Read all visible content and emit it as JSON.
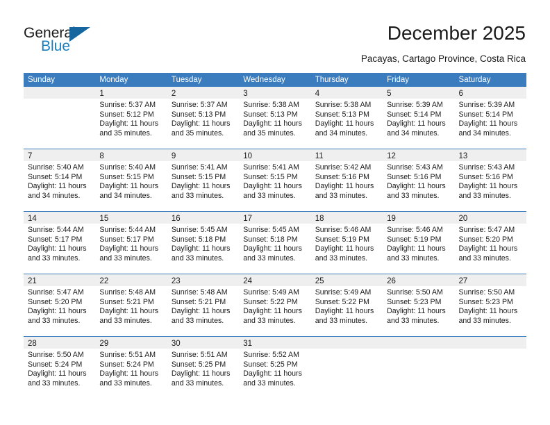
{
  "brand": {
    "name_top": "General",
    "name_bottom": "Blue",
    "triangle_icon": "triangle-icon",
    "accent_color": "#1a7fc1",
    "triangle_color": "#15659e"
  },
  "header": {
    "title": "December 2025",
    "subtitle": "Pacayas, Cartago Province, Costa Rica"
  },
  "calendar": {
    "header_bg": "#3a7cbe",
    "daynum_bg": "#efefef",
    "weekdays": [
      "Sunday",
      "Monday",
      "Tuesday",
      "Wednesday",
      "Thursday",
      "Friday",
      "Saturday"
    ],
    "weeks": [
      [
        {
          "day": "",
          "lines": []
        },
        {
          "day": "1",
          "lines": [
            "Sunrise: 5:37 AM",
            "Sunset: 5:12 PM",
            "Daylight: 11 hours",
            "and 35 minutes."
          ]
        },
        {
          "day": "2",
          "lines": [
            "Sunrise: 5:37 AM",
            "Sunset: 5:13 PM",
            "Daylight: 11 hours",
            "and 35 minutes."
          ]
        },
        {
          "day": "3",
          "lines": [
            "Sunrise: 5:38 AM",
            "Sunset: 5:13 PM",
            "Daylight: 11 hours",
            "and 35 minutes."
          ]
        },
        {
          "day": "4",
          "lines": [
            "Sunrise: 5:38 AM",
            "Sunset: 5:13 PM",
            "Daylight: 11 hours",
            "and 34 minutes."
          ]
        },
        {
          "day": "5",
          "lines": [
            "Sunrise: 5:39 AM",
            "Sunset: 5:14 PM",
            "Daylight: 11 hours",
            "and 34 minutes."
          ]
        },
        {
          "day": "6",
          "lines": [
            "Sunrise: 5:39 AM",
            "Sunset: 5:14 PM",
            "Daylight: 11 hours",
            "and 34 minutes."
          ]
        }
      ],
      [
        {
          "day": "7",
          "lines": [
            "Sunrise: 5:40 AM",
            "Sunset: 5:14 PM",
            "Daylight: 11 hours",
            "and 34 minutes."
          ]
        },
        {
          "day": "8",
          "lines": [
            "Sunrise: 5:40 AM",
            "Sunset: 5:15 PM",
            "Daylight: 11 hours",
            "and 34 minutes."
          ]
        },
        {
          "day": "9",
          "lines": [
            "Sunrise: 5:41 AM",
            "Sunset: 5:15 PM",
            "Daylight: 11 hours",
            "and 33 minutes."
          ]
        },
        {
          "day": "10",
          "lines": [
            "Sunrise: 5:41 AM",
            "Sunset: 5:15 PM",
            "Daylight: 11 hours",
            "and 33 minutes."
          ]
        },
        {
          "day": "11",
          "lines": [
            "Sunrise: 5:42 AM",
            "Sunset: 5:16 PM",
            "Daylight: 11 hours",
            "and 33 minutes."
          ]
        },
        {
          "day": "12",
          "lines": [
            "Sunrise: 5:43 AM",
            "Sunset: 5:16 PM",
            "Daylight: 11 hours",
            "and 33 minutes."
          ]
        },
        {
          "day": "13",
          "lines": [
            "Sunrise: 5:43 AM",
            "Sunset: 5:16 PM",
            "Daylight: 11 hours",
            "and 33 minutes."
          ]
        }
      ],
      [
        {
          "day": "14",
          "lines": [
            "Sunrise: 5:44 AM",
            "Sunset: 5:17 PM",
            "Daylight: 11 hours",
            "and 33 minutes."
          ]
        },
        {
          "day": "15",
          "lines": [
            "Sunrise: 5:44 AM",
            "Sunset: 5:17 PM",
            "Daylight: 11 hours",
            "and 33 minutes."
          ]
        },
        {
          "day": "16",
          "lines": [
            "Sunrise: 5:45 AM",
            "Sunset: 5:18 PM",
            "Daylight: 11 hours",
            "and 33 minutes."
          ]
        },
        {
          "day": "17",
          "lines": [
            "Sunrise: 5:45 AM",
            "Sunset: 5:18 PM",
            "Daylight: 11 hours",
            "and 33 minutes."
          ]
        },
        {
          "day": "18",
          "lines": [
            "Sunrise: 5:46 AM",
            "Sunset: 5:19 PM",
            "Daylight: 11 hours",
            "and 33 minutes."
          ]
        },
        {
          "day": "19",
          "lines": [
            "Sunrise: 5:46 AM",
            "Sunset: 5:19 PM",
            "Daylight: 11 hours",
            "and 33 minutes."
          ]
        },
        {
          "day": "20",
          "lines": [
            "Sunrise: 5:47 AM",
            "Sunset: 5:20 PM",
            "Daylight: 11 hours",
            "and 33 minutes."
          ]
        }
      ],
      [
        {
          "day": "21",
          "lines": [
            "Sunrise: 5:47 AM",
            "Sunset: 5:20 PM",
            "Daylight: 11 hours",
            "and 33 minutes."
          ]
        },
        {
          "day": "22",
          "lines": [
            "Sunrise: 5:48 AM",
            "Sunset: 5:21 PM",
            "Daylight: 11 hours",
            "and 33 minutes."
          ]
        },
        {
          "day": "23",
          "lines": [
            "Sunrise: 5:48 AM",
            "Sunset: 5:21 PM",
            "Daylight: 11 hours",
            "and 33 minutes."
          ]
        },
        {
          "day": "24",
          "lines": [
            "Sunrise: 5:49 AM",
            "Sunset: 5:22 PM",
            "Daylight: 11 hours",
            "and 33 minutes."
          ]
        },
        {
          "day": "25",
          "lines": [
            "Sunrise: 5:49 AM",
            "Sunset: 5:22 PM",
            "Daylight: 11 hours",
            "and 33 minutes."
          ]
        },
        {
          "day": "26",
          "lines": [
            "Sunrise: 5:50 AM",
            "Sunset: 5:23 PM",
            "Daylight: 11 hours",
            "and 33 minutes."
          ]
        },
        {
          "day": "27",
          "lines": [
            "Sunrise: 5:50 AM",
            "Sunset: 5:23 PM",
            "Daylight: 11 hours",
            "and 33 minutes."
          ]
        }
      ],
      [
        {
          "day": "28",
          "lines": [
            "Sunrise: 5:50 AM",
            "Sunset: 5:24 PM",
            "Daylight: 11 hours",
            "and 33 minutes."
          ]
        },
        {
          "day": "29",
          "lines": [
            "Sunrise: 5:51 AM",
            "Sunset: 5:24 PM",
            "Daylight: 11 hours",
            "and 33 minutes."
          ]
        },
        {
          "day": "30",
          "lines": [
            "Sunrise: 5:51 AM",
            "Sunset: 5:25 PM",
            "Daylight: 11 hours",
            "and 33 minutes."
          ]
        },
        {
          "day": "31",
          "lines": [
            "Sunrise: 5:52 AM",
            "Sunset: 5:25 PM",
            "Daylight: 11 hours",
            "and 33 minutes."
          ]
        },
        {
          "day": "",
          "lines": []
        },
        {
          "day": "",
          "lines": []
        },
        {
          "day": "",
          "lines": []
        }
      ]
    ]
  }
}
